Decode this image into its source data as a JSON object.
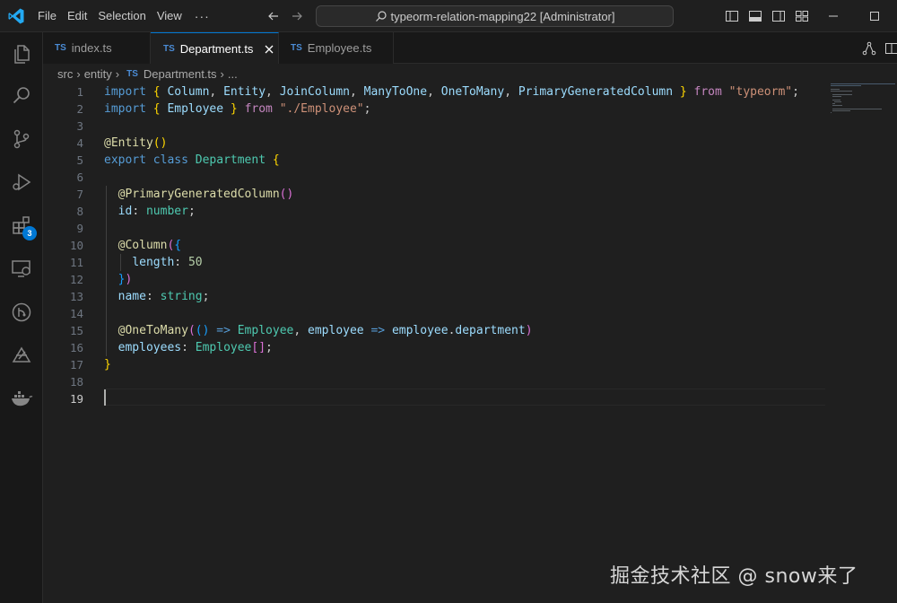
{
  "titlebar": {
    "menu": [
      "File",
      "Edit",
      "Selection",
      "View"
    ],
    "more": "···",
    "search_text": "typeorm-relation-mapping22 [Administrator]"
  },
  "activity": {
    "icons": [
      "files-icon",
      "search-icon",
      "source-control-icon",
      "run-debug-icon",
      "extensions-icon",
      "remote-explorer-icon",
      "git-graph-icon",
      "testing-icon",
      "docker-icon"
    ],
    "extensions_badge": "3"
  },
  "tabs": [
    {
      "lang": "TS",
      "label": "index.ts"
    },
    {
      "lang": "TS",
      "label": "Department.ts"
    },
    {
      "lang": "TS",
      "label": "Employee.ts"
    }
  ],
  "breadcrumb": {
    "parts": [
      "src",
      "entity",
      "Department.ts",
      "..."
    ],
    "lang": "TS"
  },
  "editor": {
    "line_numbers": [
      "1",
      "2",
      "3",
      "4",
      "5",
      "6",
      "7",
      "8",
      "9",
      "10",
      "11",
      "12",
      "13",
      "14",
      "15",
      "16",
      "17",
      "18",
      "19"
    ],
    "current_line": "19"
  },
  "colors": {
    "accent": "#0078d4",
    "keyword": "#569cd6",
    "control": "#c586c0",
    "variable": "#9cdcfe",
    "type": "#4ec9b0",
    "function": "#dcdcaa",
    "string": "#ce9178",
    "number": "#b5cea8"
  },
  "watermark": "掘金技术社区 @ snow来了"
}
